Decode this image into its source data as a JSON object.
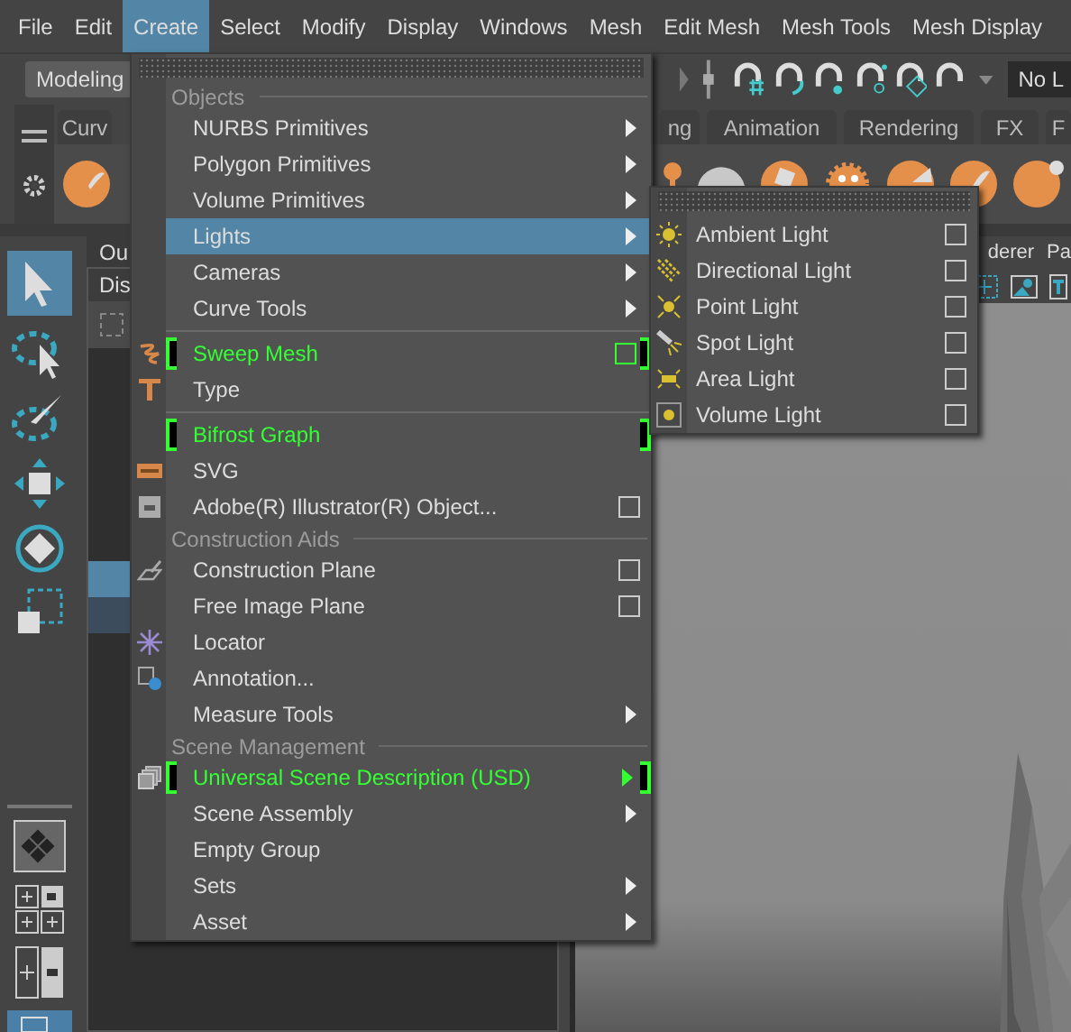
{
  "menu_bar": [
    {
      "label": "File",
      "selected": false
    },
    {
      "label": "Edit",
      "selected": false
    },
    {
      "label": "Create",
      "selected": true
    },
    {
      "label": "Select",
      "selected": false
    },
    {
      "label": "Modify",
      "selected": false
    },
    {
      "label": "Display",
      "selected": false
    },
    {
      "label": "Windows",
      "selected": false
    },
    {
      "label": "Mesh",
      "selected": false
    },
    {
      "label": "Edit Mesh",
      "selected": false
    },
    {
      "label": "Mesh Tools",
      "selected": false
    },
    {
      "label": "Mesh Display",
      "selected": false
    }
  ],
  "toolbar": {
    "mode": "Modeling",
    "field_value": "No L"
  },
  "shelf_tabs": [
    {
      "label": "Curv",
      "selected": false
    },
    {
      "label": "ng",
      "selected": false
    },
    {
      "label": "Animation",
      "selected": false
    },
    {
      "label": "Rendering",
      "selected": false
    },
    {
      "label": "FX",
      "selected": false
    },
    {
      "label": "F",
      "selected": false
    }
  ],
  "outliner": {
    "tab": "Ou",
    "menu": "Dis"
  },
  "viewport": {
    "menu": [
      "derer",
      "Pa"
    ]
  },
  "create_menu": {
    "sections": [
      {
        "heading": "Objects",
        "groups": [
          [
            {
              "label": "NURBS Primitives",
              "submenu": true,
              "option_box": false,
              "selected": false,
              "highlighted": false
            },
            {
              "label": "Polygon Primitives",
              "submenu": true,
              "option_box": false,
              "selected": false,
              "highlighted": false
            },
            {
              "label": "Volume Primitives",
              "submenu": true,
              "option_box": false,
              "selected": false,
              "highlighted": false
            },
            {
              "label": "Lights",
              "submenu": true,
              "option_box": false,
              "selected": true,
              "highlighted": false
            },
            {
              "label": "Cameras",
              "submenu": true,
              "option_box": false,
              "selected": false,
              "highlighted": false
            },
            {
              "label": "Curve Tools",
              "submenu": true,
              "option_box": false,
              "selected": false,
              "highlighted": false
            }
          ],
          [
            {
              "label": "Sweep Mesh",
              "submenu": false,
              "option_box": true,
              "selected": false,
              "highlighted": true
            },
            {
              "label": "Type",
              "submenu": false,
              "option_box": false,
              "selected": false,
              "highlighted": false
            }
          ],
          [
            {
              "label": "Bifrost Graph",
              "submenu": false,
              "option_box": false,
              "selected": false,
              "highlighted": true
            },
            {
              "label": "SVG",
              "submenu": false,
              "option_box": false,
              "selected": false,
              "highlighted": false
            },
            {
              "label": "Adobe(R) Illustrator(R) Object...",
              "submenu": false,
              "option_box": true,
              "selected": false,
              "highlighted": false
            }
          ]
        ]
      },
      {
        "heading": "Construction Aids",
        "groups": [
          [
            {
              "label": "Construction Plane",
              "submenu": false,
              "option_box": true,
              "selected": false,
              "highlighted": false
            },
            {
              "label": "Free Image Plane",
              "submenu": false,
              "option_box": true,
              "selected": false,
              "highlighted": false
            },
            {
              "label": "Locator",
              "submenu": false,
              "option_box": false,
              "selected": false,
              "highlighted": false
            },
            {
              "label": "Annotation...",
              "submenu": false,
              "option_box": false,
              "selected": false,
              "highlighted": false
            },
            {
              "label": "Measure Tools",
              "submenu": true,
              "option_box": false,
              "selected": false,
              "highlighted": false
            }
          ]
        ]
      },
      {
        "heading": "Scene Management",
        "groups": [
          [
            {
              "label": "Universal Scene Description (USD)",
              "submenu": true,
              "option_box": false,
              "selected": false,
              "highlighted": true
            },
            {
              "label": "Scene Assembly",
              "submenu": true,
              "option_box": false,
              "selected": false,
              "highlighted": false
            },
            {
              "label": "Empty Group",
              "submenu": false,
              "option_box": false,
              "selected": false,
              "highlighted": false
            },
            {
              "label": "Sets",
              "submenu": true,
              "option_box": false,
              "selected": false,
              "highlighted": false
            },
            {
              "label": "Asset",
              "submenu": true,
              "option_box": false,
              "selected": false,
              "highlighted": false
            }
          ]
        ]
      }
    ]
  },
  "lights_menu": {
    "items": [
      {
        "label": "Ambient Light",
        "option_box": true
      },
      {
        "label": "Directional Light",
        "option_box": true
      },
      {
        "label": "Point Light",
        "option_box": true
      },
      {
        "label": "Spot Light",
        "option_box": true
      },
      {
        "label": "Area Light",
        "option_box": true
      },
      {
        "label": "Volume Light",
        "option_box": true
      }
    ]
  }
}
